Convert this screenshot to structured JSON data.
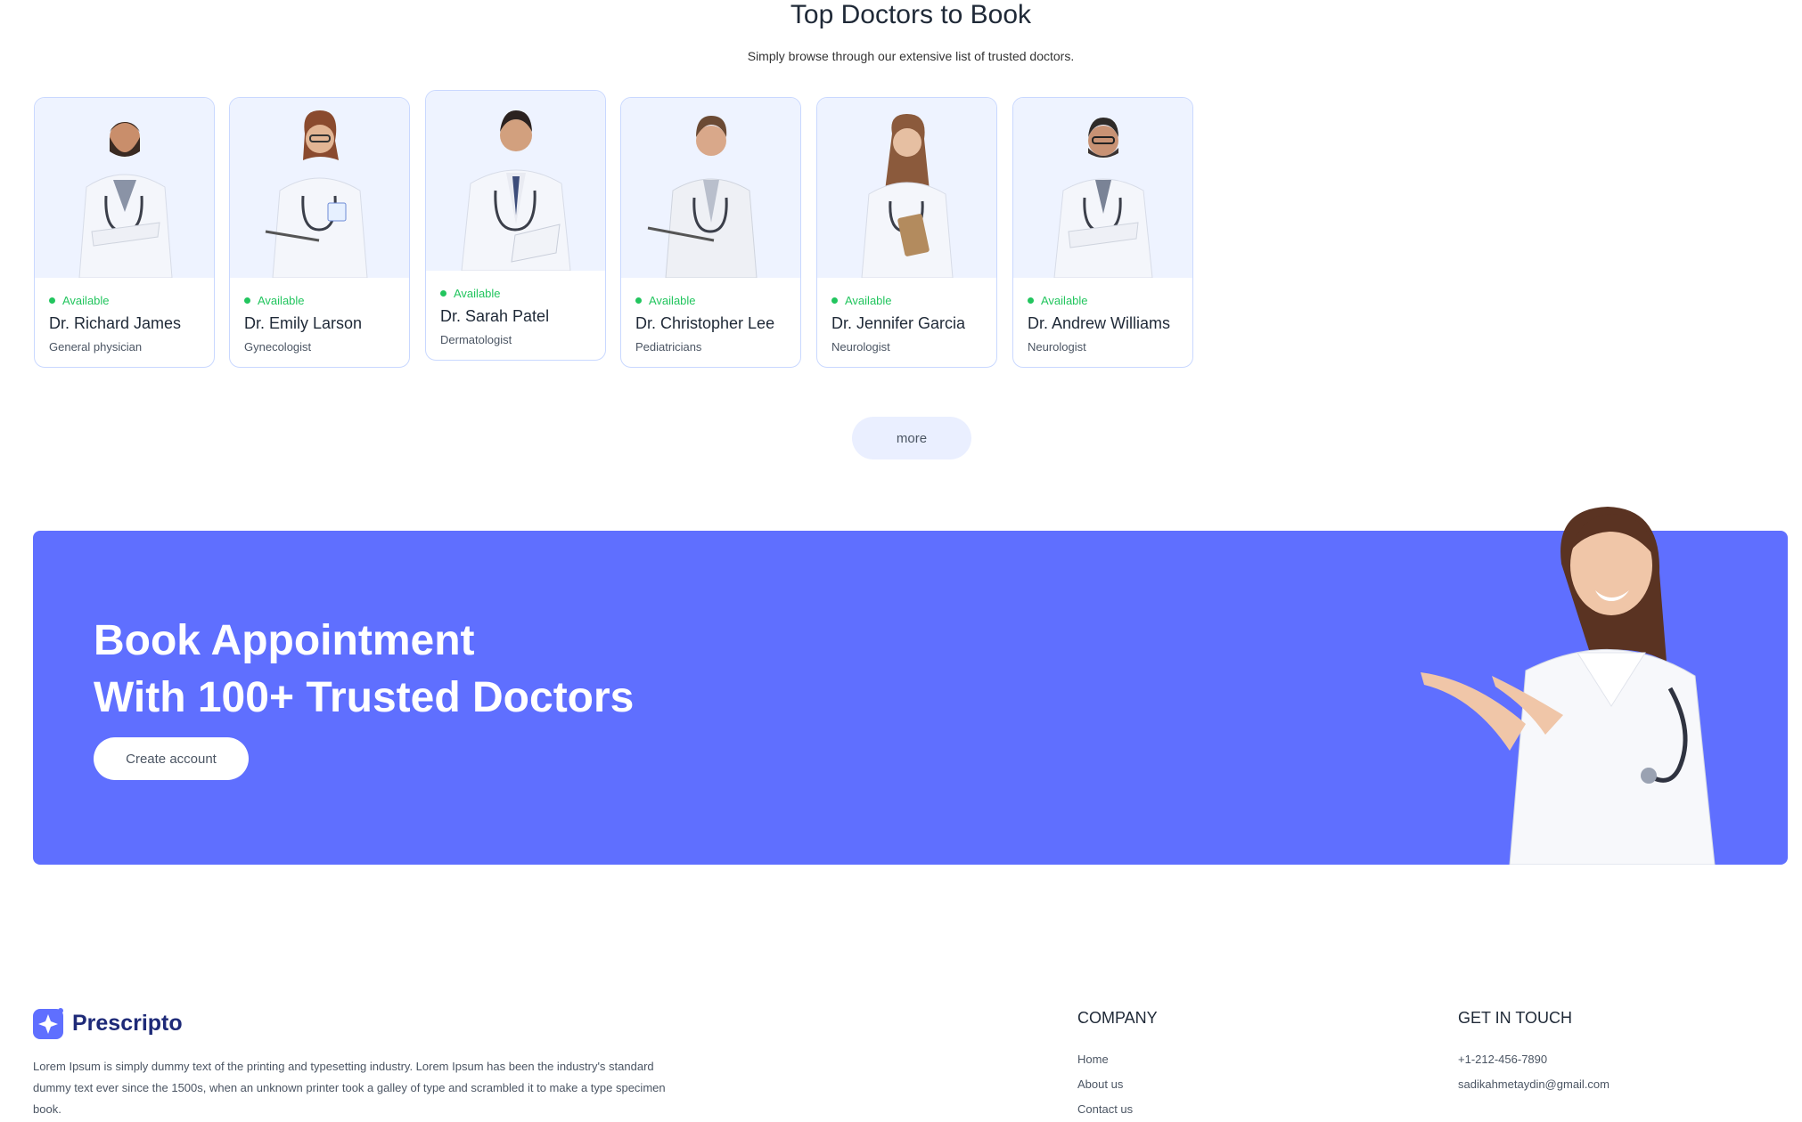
{
  "section": {
    "title": "Top Doctors to Book",
    "subtitle": "Simply browse through our extensive list of trusted doctors."
  },
  "doctors": [
    {
      "status": "Available",
      "name": "Dr. Richard James",
      "speciality": "General physician"
    },
    {
      "status": "Available",
      "name": "Dr. Emily Larson",
      "speciality": "Gynecologist"
    },
    {
      "status": "Available",
      "name": "Dr. Sarah Patel",
      "speciality": "Dermatologist"
    },
    {
      "status": "Available",
      "name": "Dr. Christopher Lee",
      "speciality": "Pediatricians"
    },
    {
      "status": "Available",
      "name": "Dr. Jennifer Garcia",
      "speciality": "Neurologist"
    },
    {
      "status": "Available",
      "name": "Dr. Andrew Williams",
      "speciality": "Neurologist"
    }
  ],
  "more_label": "more",
  "banner": {
    "line1": "Book Appointment",
    "line2": "With 100+ Trusted Doctors",
    "cta_label": "Create account"
  },
  "footer": {
    "brand": "Prescripto",
    "description": "Lorem Ipsum is simply dummy text of the printing and typesetting industry. Lorem Ipsum has been the industry's standard dummy text ever since the 1500s, when an unknown printer took a galley of type and scrambled it to make a type specimen book.",
    "company_title": "COMPANY",
    "company_links": [
      "Home",
      "About us",
      "Contact us"
    ],
    "contact_title": "GET IN TOUCH",
    "phone": "+1-212-456-7890",
    "email": "sadikahmetaydin@gmail.com"
  },
  "colors": {
    "accent": "#5f6fff",
    "available": "#22c55e",
    "card_bg": "#eef3ff",
    "brand_text": "#1e2a78"
  }
}
